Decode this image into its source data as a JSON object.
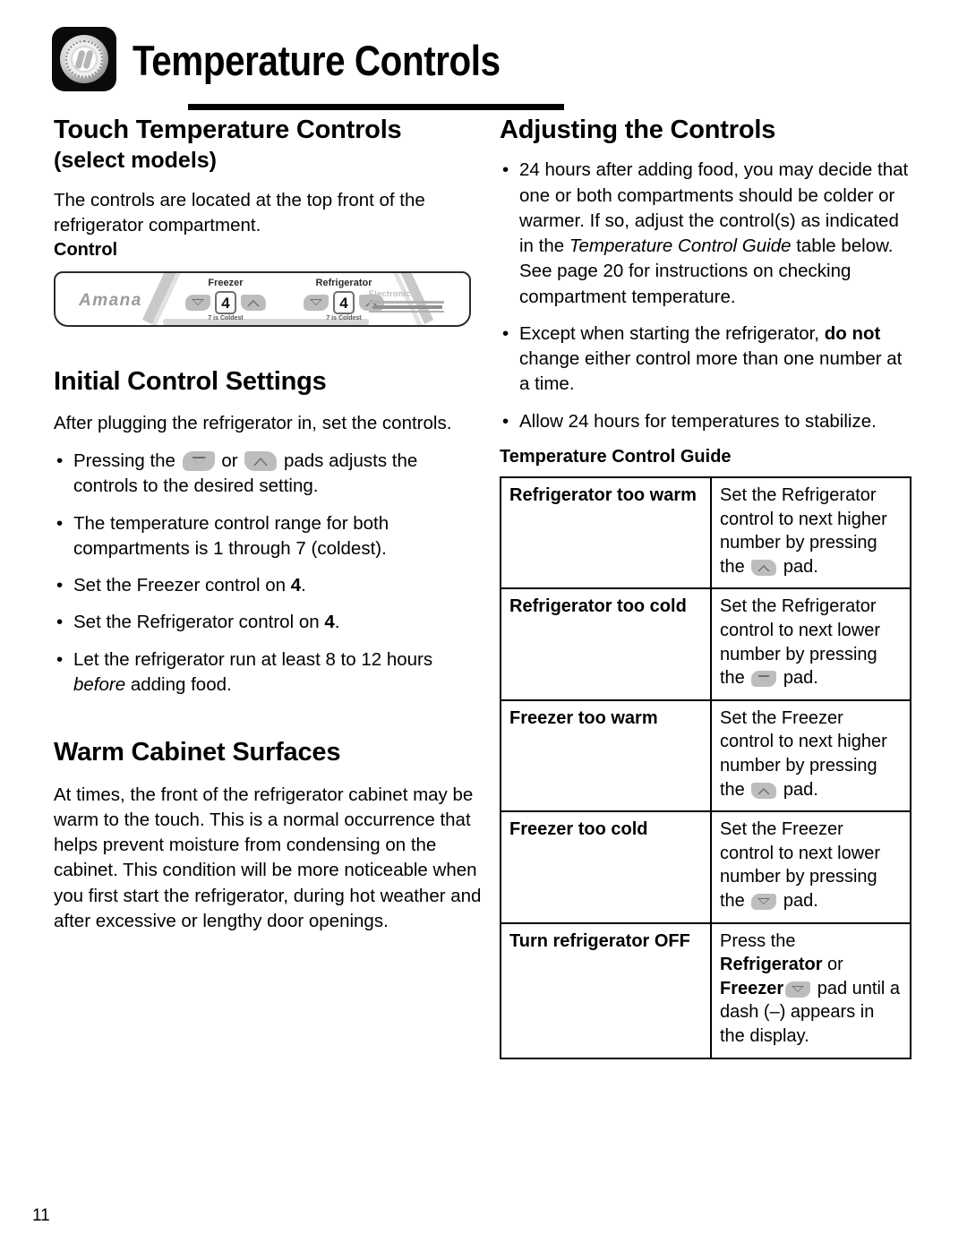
{
  "header": {
    "title": "Temperature Controls",
    "icon": "dial-control-icon"
  },
  "left_column": {
    "section_title": "Touch Temperature Controls",
    "section_subtitle": "(select models)",
    "intro": "The controls are located at the top front of the refrigerator compartment.",
    "control_label": "Control",
    "control_panel": {
      "brand": "Amana",
      "freezer_label": "Freezer",
      "freezer_value": "4",
      "freezer_sub": "7 is Coldest",
      "refrigerator_label": "Refrigerator",
      "refrigerator_value": "4",
      "refrigerator_sub": "7 is Coldest",
      "electronic_label": "Electronic",
      "down_pad": "down-arrow-pad-icon",
      "up_pad": "up-arrow-pad-icon"
    },
    "initial_settings": {
      "title": "Initial Control Settings",
      "intro": "After plugging the refrigerator in, set the controls.",
      "bullets": [
        {
          "pre": "Pressing the ",
          "mid": " or ",
          "post": " pads adjusts the controls to the desired setting."
        },
        {
          "text": "The temperature control range for both compartments is 1 through 7 (coldest)."
        },
        {
          "pre": "Set the Freezer control on ",
          "bold": "4",
          "post": "."
        },
        {
          "pre": "Set the Refrigerator control on ",
          "bold": "4",
          "post": "."
        },
        {
          "pre": "Let the refrigerator run at least 8 to 12 hours ",
          "italic": "before",
          "post": " adding food."
        }
      ]
    },
    "warm_cabinet": {
      "title": "Warm Cabinet Surfaces",
      "body": "At times, the front of the refrigerator cabinet may be warm to the touch. This is a normal occurrence that helps prevent moisture from condensing on the cabinet. This condition will be more noticeable when you first start the refrigerator, during hot weather and after excessive or lengthy door openings."
    }
  },
  "right_column": {
    "section_title": "Adjusting the Controls",
    "bullets": [
      {
        "pre": "24 hours after adding food, you may decide that one or both compartments should be colder or warmer. If so, adjust the control(s) as indicated in the ",
        "italic": "Temperature Control Guide",
        "post": " table below. See page 20 for instructions on checking compartment temperature."
      },
      {
        "pre": "Except when starting the refrigerator, ",
        "bold": "do not",
        "post": " change either control more than one number at a time."
      },
      {
        "text": "Allow 24 hours for temperatures to stabilize."
      }
    ],
    "guide_title": "Temperature Control Guide",
    "guide_rows": [
      {
        "condition": "Refrigerator too warm",
        "action_pre": "Set the Refrigerator control to next higher number by pressing the ",
        "action_pad": "up-arrow-pad-icon",
        "action_post": " pad."
      },
      {
        "condition": "Refrigerator too cold",
        "action_pre": "Set the Refrigerator control to next lower number by pressing the ",
        "action_pad": "down-arrow-pad-icon",
        "action_post": " pad."
      },
      {
        "condition": "Freezer too warm",
        "action_pre": "Set the Freezer control to next higher number by pressing the ",
        "action_pad": "up-arrow-pad-icon",
        "action_post": " pad."
      },
      {
        "condition": "Freezer too cold",
        "action_pre": "Set the Freezer control to next lower number by pressing the ",
        "action_pad": "down-arrow-pad-icon",
        "action_post": " pad."
      },
      {
        "condition": "Turn refrigerator OFF",
        "action_pre": "Press the ",
        "action_bold1": "Refrigerator",
        "action_mid": " or ",
        "action_bold2": "Freezer",
        "action_pad": "down-arrow-pad-icon",
        "action_post": " pad until a dash (–) appears in the display."
      }
    ]
  },
  "footer": {
    "page_number": "11"
  }
}
